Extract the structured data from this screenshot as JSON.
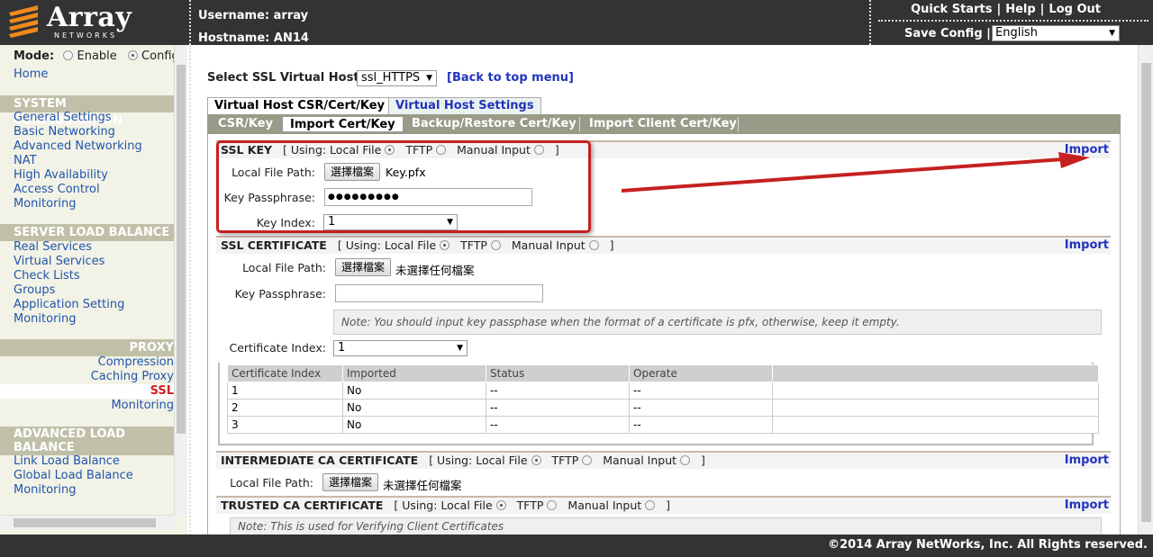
{
  "header": {
    "logo_text": "Array",
    "logo_sub": "NETWORKS",
    "username_label": "Username: array",
    "hostname_label": "Hostname: AN14",
    "links": [
      "Quick Starts",
      "Help",
      "Log Out"
    ],
    "save_config": "Save Config",
    "language": "English"
  },
  "sidebar": {
    "mode_label": "Mode:",
    "mode_enable": "Enable",
    "mode_config": "Config",
    "home": "Home",
    "sections": [
      {
        "title": "SYSTEM CONFIGURATION",
        "items": [
          "General Settings",
          "Basic Networking",
          "Advanced Networking",
          "NAT",
          "High Availability",
          "Access Control",
          "Monitoring"
        ]
      },
      {
        "title": "SERVER LOAD BALANCE",
        "items": [
          "Real Services",
          "Virtual Services",
          "Check Lists",
          "Groups",
          "Application Setting",
          "Monitoring"
        ]
      },
      {
        "title": "PROXY",
        "items": [
          "Compression",
          "Caching Proxy",
          "SSL",
          "Monitoring"
        ]
      },
      {
        "title": "ADVANCED LOAD BALANCE",
        "items": [
          "Link Load Balance",
          "Global Load Balance",
          "Monitoring"
        ]
      }
    ]
  },
  "main": {
    "select_host_label": "Select SSL Virtual Host:",
    "select_host_value": "ssl_HTTPS",
    "back_link": "[Back to top menu]",
    "tabs": [
      "Virtual Host CSR/Cert/Key",
      "Virtual Host Settings"
    ],
    "subtabs": [
      "CSR/Key",
      "Import Cert/Key",
      "Backup/Restore Cert/Key",
      "Import Client Cert/Key"
    ],
    "ssl_key": {
      "title": "SSL KEY",
      "using": "[ Using: Local File",
      "tftp": "TFTP",
      "manual": "Manual Input",
      "close": "]",
      "import": "Import",
      "path_label": "Local File Path:",
      "choose_btn": "選擇檔案",
      "file_name": "Key.pfx",
      "pass_label": "Key Passphrase:",
      "pass_value": "●●●●●●●●●",
      "index_label": "Key Index:",
      "index_value": "1"
    },
    "ssl_cert": {
      "title": "SSL CERTIFICATE",
      "using": "[ Using: Local File",
      "tftp": "TFTP",
      "manual": "Manual Input",
      "close": "]",
      "import": "Import",
      "path_label": "Local File Path:",
      "choose_btn": "選擇檔案",
      "file_name": "未選擇任何檔案",
      "pass_label": "Key Passphrase:",
      "note": "Note: You should input key passphase when the format of a certificate is pfx, otherwise, keep it empty.",
      "index_label": "Certificate Index:",
      "index_value": "1"
    },
    "cert_table": {
      "headers": [
        "Certificate Index",
        "Imported",
        "Status",
        "Operate",
        ""
      ],
      "rows": [
        [
          "1",
          "No",
          "--",
          "--",
          ""
        ],
        [
          "2",
          "No",
          "--",
          "--",
          ""
        ],
        [
          "3",
          "No",
          "--",
          "--",
          ""
        ]
      ]
    },
    "inter_ca": {
      "title": "INTERMEDIATE CA CERTIFICATE",
      "using": "[ Using: Local File",
      "tftp": "TFTP",
      "manual": "Manual Input",
      "close": "]",
      "import": "Import",
      "path_label": "Local File Path:",
      "choose_btn": "選擇檔案",
      "file_name": "未選擇任何檔案"
    },
    "trusted_ca": {
      "title": "TRUSTED CA CERTIFICATE",
      "using": "[ Using: Local File",
      "tftp": "TFTP",
      "manual": "Manual Input",
      "close": "]",
      "import": "Import",
      "note": "Note: This is used for Verifying Client Certificates"
    }
  },
  "footer": {
    "copyright": "©2014 Array NetWorks, Inc. All Rights reserved."
  },
  "colors": {
    "header_bg": "#333333",
    "link": "#2255aa",
    "active_nav": "#cc2222",
    "annotation_red": "#c62020",
    "section_bar": "#c0c0a8"
  }
}
